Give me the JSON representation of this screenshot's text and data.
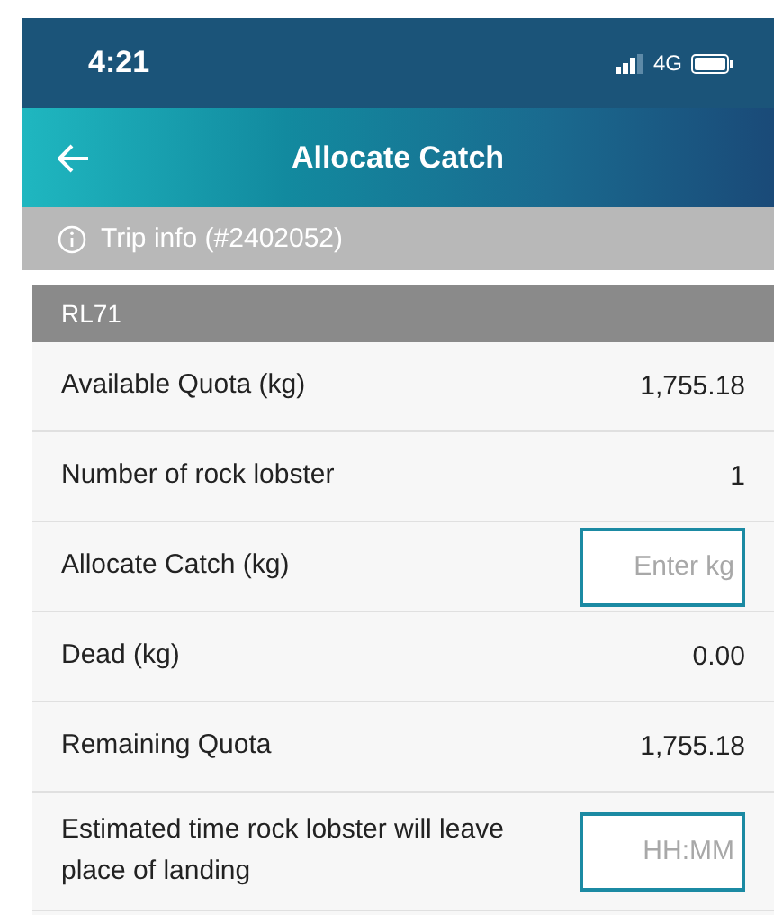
{
  "status_bar": {
    "time": "4:21",
    "network": "4G"
  },
  "header": {
    "title": "Allocate Catch"
  },
  "trip_info": {
    "label": "Trip info (#2402052)"
  },
  "section": {
    "title": "RL71"
  },
  "rows": [
    {
      "kind": "value",
      "label": "Available Quota (kg)",
      "value": "1,755.18"
    },
    {
      "kind": "value",
      "label": "Number of rock lobster",
      "value": "1"
    },
    {
      "kind": "input",
      "label": "Allocate Catch (kg)",
      "placeholder": "Enter kg"
    },
    {
      "kind": "value",
      "label": "Dead (kg)",
      "value": "0.00"
    },
    {
      "kind": "value",
      "label": "Remaining Quota",
      "value": "1,755.18"
    },
    {
      "kind": "input",
      "label": "Estimated time rock lobster will leave place of landing",
      "placeholder": "HH:MM"
    }
  ]
}
